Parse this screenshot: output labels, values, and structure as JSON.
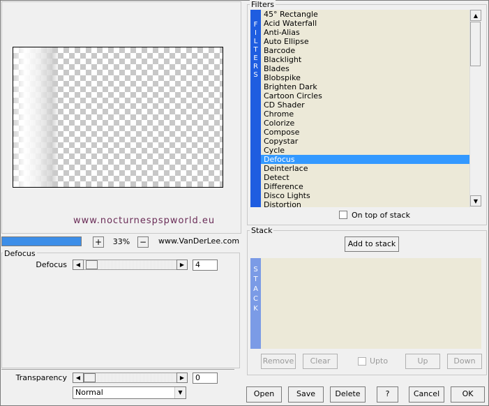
{
  "preview": {
    "watermark": "www.nocturnespspworld.eu"
  },
  "zoom": {
    "progress_fraction": 1.0,
    "plus_label": "+",
    "value": "33%",
    "minus_label": "−",
    "credit": "www.VanDerLee.com"
  },
  "params": {
    "group_title": "Defocus",
    "defocus": {
      "label": "Defocus",
      "value": "4",
      "level_fraction": 0.03
    },
    "transparency": {
      "label": "Transparency",
      "value": "0",
      "level_fraction": 0.0
    },
    "blend_mode": "Normal"
  },
  "filters": {
    "group_title": "Filters",
    "side_label": [
      "F",
      "I",
      "L",
      "T",
      "E",
      "R",
      "S"
    ],
    "items": [
      "45° Rectangle",
      "Acid Waterfall",
      "Anti-Alias",
      "Auto Ellipse",
      "Barcode",
      "Blacklight",
      "Blades",
      "Blobspike",
      "Brighten Dark",
      "Cartoon Circles",
      "CD Shader",
      "Chrome",
      "Colorize",
      "Compose",
      "Copystar",
      "Cycle",
      "Defocus",
      "Deinterlace",
      "Detect",
      "Difference",
      "Disco Lights",
      "Distortion"
    ],
    "selected_index": 16,
    "on_top_label": "On top of stack",
    "on_top_checked": false
  },
  "stack": {
    "group_title": "Stack",
    "add_label": "Add to stack",
    "side_label": [
      "S",
      "T",
      "A",
      "C",
      "K"
    ],
    "remove_label": "Remove",
    "clear_label": "Clear",
    "upto_label": "Upto",
    "up_label": "Up",
    "down_label": "Down"
  },
  "footer": {
    "open_label": "Open",
    "save_label": "Save",
    "delete_label": "Delete",
    "help_label": "?",
    "cancel_label": "Cancel",
    "ok_label": "OK"
  },
  "icons": {
    "arrow_left": "◀",
    "arrow_right": "▶",
    "arrow_up": "▲",
    "arrow_down": "▼"
  },
  "colors": {
    "accent": "#3399ff",
    "filters_bar": "#1f5de0",
    "stack_bar": "#7b9be6",
    "list_bg": "#ece9d8",
    "watermark": "#6a2c57"
  }
}
